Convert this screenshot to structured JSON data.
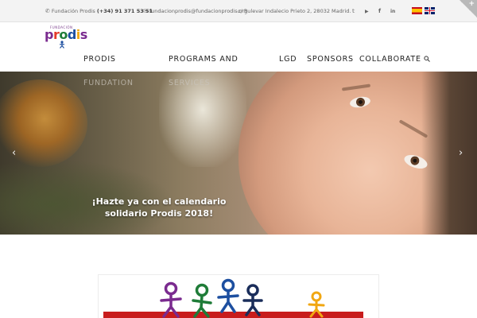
{
  "topbar": {
    "phone_label": "Fundación Prodis",
    "phone_number": "(+34) 91 371 53 51",
    "email": "fundacionprodis@fundacionprodis.org",
    "address": "c/ Bulevar Indalecio Prieto 2, 28032 Madrid.",
    "social": [
      "twitter-icon",
      "youtube-icon",
      "facebook-icon",
      "linkedin-icon"
    ],
    "social_glyphs": [
      "𝕥",
      "▶",
      "f",
      "in"
    ],
    "languages": [
      "es",
      "en"
    ]
  },
  "logo": {
    "small_text": "FUNDACIÓN",
    "letters": [
      "p",
      "r",
      "o",
      "d",
      "i",
      "s"
    ]
  },
  "nav": {
    "items": [
      "PRODIS",
      "PROGRAMS AND",
      "LGD",
      "SPONSORS",
      "COLLABORATE"
    ],
    "sub_labels": [
      "FUNDATION",
      "SERVICES"
    ]
  },
  "hero": {
    "caption_line1": "¡Hazte ya con el calendario",
    "caption_line2": "solidario Prodis 2018!",
    "prev": "‹",
    "next": "›"
  },
  "colors": {
    "logo_purple": "#7a2b8f",
    "logo_red": "#e43a2a",
    "logo_green": "#1f7c38",
    "logo_blue": "#1d4fa0",
    "logo_yellow": "#f1a712",
    "promo_red": "#c81c1c"
  }
}
